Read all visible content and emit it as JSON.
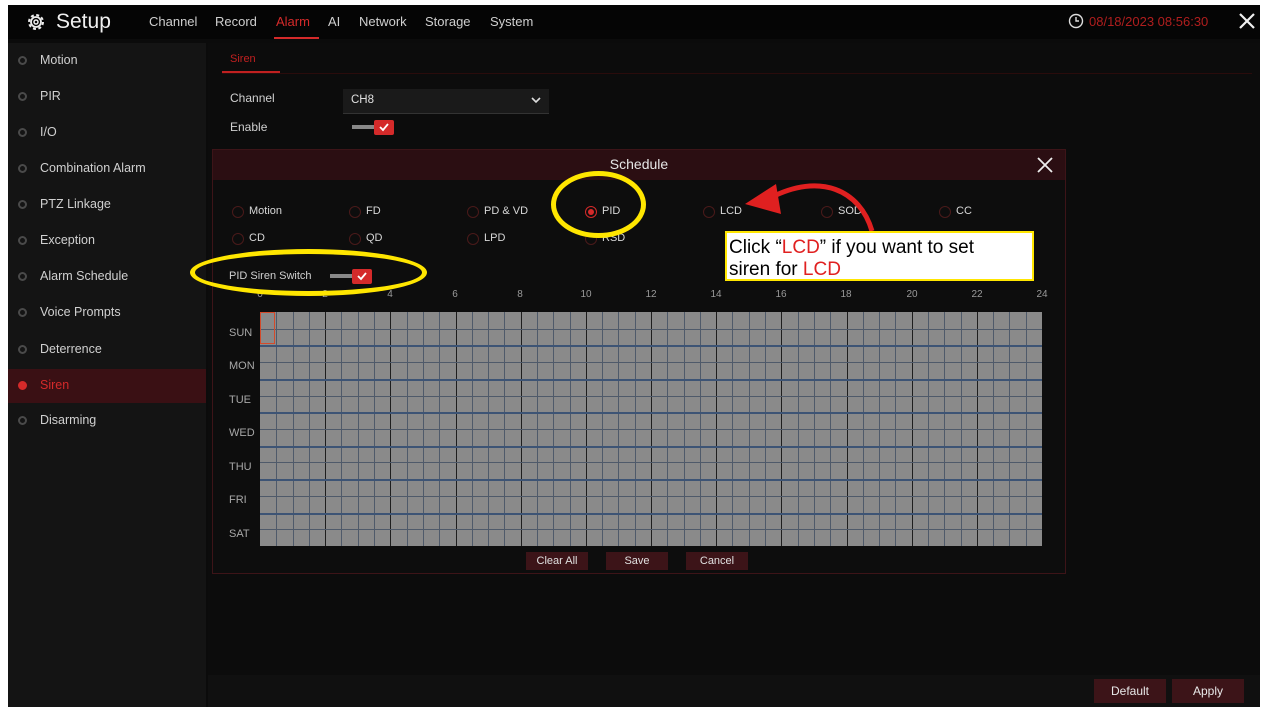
{
  "header": {
    "title": "Setup",
    "tabs": [
      {
        "label": "Channel",
        "active": false
      },
      {
        "label": "Record",
        "active": false
      },
      {
        "label": "Alarm",
        "active": true
      },
      {
        "label": "AI",
        "active": false
      },
      {
        "label": "Network",
        "active": false
      },
      {
        "label": "Storage",
        "active": false
      },
      {
        "label": "System",
        "active": false
      }
    ],
    "datetime": "08/18/2023 08:56:30",
    "accent_color": "#d42a2a"
  },
  "sidebar": {
    "items": [
      {
        "label": "Motion",
        "active": false
      },
      {
        "label": "PIR",
        "active": false
      },
      {
        "label": "I/O",
        "active": false
      },
      {
        "label": "Combination Alarm",
        "active": false
      },
      {
        "label": "PTZ Linkage",
        "active": false
      },
      {
        "label": "Exception",
        "active": false
      },
      {
        "label": "Alarm Schedule",
        "active": false
      },
      {
        "label": "Voice Prompts",
        "active": false
      },
      {
        "label": "Deterrence",
        "active": false
      },
      {
        "label": "Siren",
        "active": true
      },
      {
        "label": "Disarming",
        "active": false
      }
    ]
  },
  "main": {
    "subtab": "Siren",
    "channel_label": "Channel",
    "channel_value": "CH8",
    "enable_label": "Enable",
    "enable_checked": true,
    "default_label": "Default",
    "apply_label": "Apply"
  },
  "modal": {
    "title": "Schedule",
    "radios": [
      {
        "label": "Motion",
        "checked": false
      },
      {
        "label": "FD",
        "checked": false
      },
      {
        "label": "PD & VD",
        "checked": false
      },
      {
        "label": "PID",
        "checked": true
      },
      {
        "label": "LCD",
        "checked": false
      },
      {
        "label": "SOD",
        "checked": false
      },
      {
        "label": "CC",
        "checked": false
      },
      {
        "label": "CD",
        "checked": false
      },
      {
        "label": "QD",
        "checked": false
      },
      {
        "label": "LPD",
        "checked": false
      },
      {
        "label": "RSD",
        "checked": false
      }
    ],
    "switch_label": "PID Siren Switch",
    "switch_checked": true,
    "hours": [
      "0",
      "2",
      "4",
      "6",
      "8",
      "10",
      "12",
      "14",
      "16",
      "18",
      "20",
      "22",
      "24"
    ],
    "days": [
      "SUN",
      "MON",
      "TUE",
      "WED",
      "THU",
      "FRI",
      "SAT"
    ],
    "clear_label": "Clear All",
    "save_label": "Save",
    "cancel_label": "Cancel"
  },
  "annotation": {
    "line1_a": "Click “",
    "line1_b": "LCD",
    "line1_c": "” if you want to set",
    "line2_a": "siren for ",
    "line2_b": "LCD",
    "highlight_color": "#ffe600",
    "arrow_color": "#e02020"
  }
}
